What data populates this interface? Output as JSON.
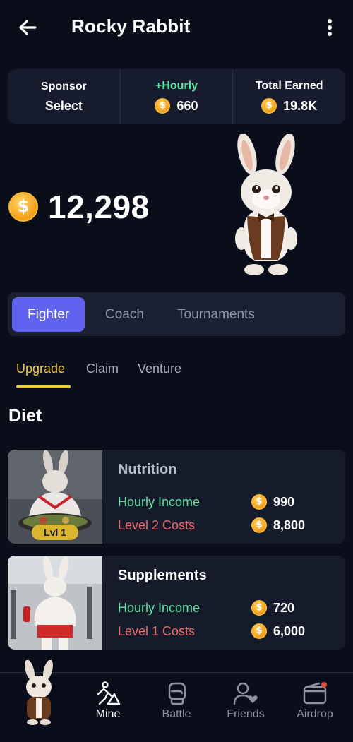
{
  "header": {
    "title": "Rocky Rabbit",
    "back_icon": "arrow-left-icon",
    "menu_icon": "more-vertical-icon"
  },
  "stats": [
    {
      "label": "Sponsor",
      "value": "Select",
      "label_color": "#ffffff"
    },
    {
      "label": "+Hourly",
      "value": "660",
      "label_color": "#5fe3a1"
    },
    {
      "label": "Total Earned",
      "value": "19.8K",
      "label_color": "#ffffff"
    }
  ],
  "balance": {
    "value": "12,298",
    "icon": "coin-icon"
  },
  "coin_symbol": "$",
  "main_tabs": [
    "Fighter",
    "Coach",
    "Tournaments"
  ],
  "sub_tabs": [
    "Upgrade",
    "Claim",
    "Venture"
  ],
  "section_title": "Diet",
  "cards": [
    {
      "title": "Nutrition",
      "income_label": "Hourly Income",
      "income_value": "990",
      "cost_label": "Level 2 Costs",
      "cost_value": "8,800",
      "badge": "Lvl 1"
    },
    {
      "title": "Supplements",
      "income_label": "Hourly Income",
      "income_value": "720",
      "cost_label": "Level 1 Costs",
      "cost_value": "6,000"
    }
  ],
  "nav": [
    {
      "label": "Mine",
      "icon": "mine-icon",
      "active": true
    },
    {
      "label": "Battle",
      "icon": "boxing-glove-icon",
      "active": false
    },
    {
      "label": "Friends",
      "icon": "friends-icon",
      "active": false
    },
    {
      "label": "Airdrop",
      "icon": "wallet-icon",
      "active": false
    }
  ],
  "colors": {
    "background": "#0a0e1b",
    "accent": "#6062f0",
    "gold": "#f3c937",
    "income": "#5fe3a1",
    "cost": "#f06868"
  }
}
